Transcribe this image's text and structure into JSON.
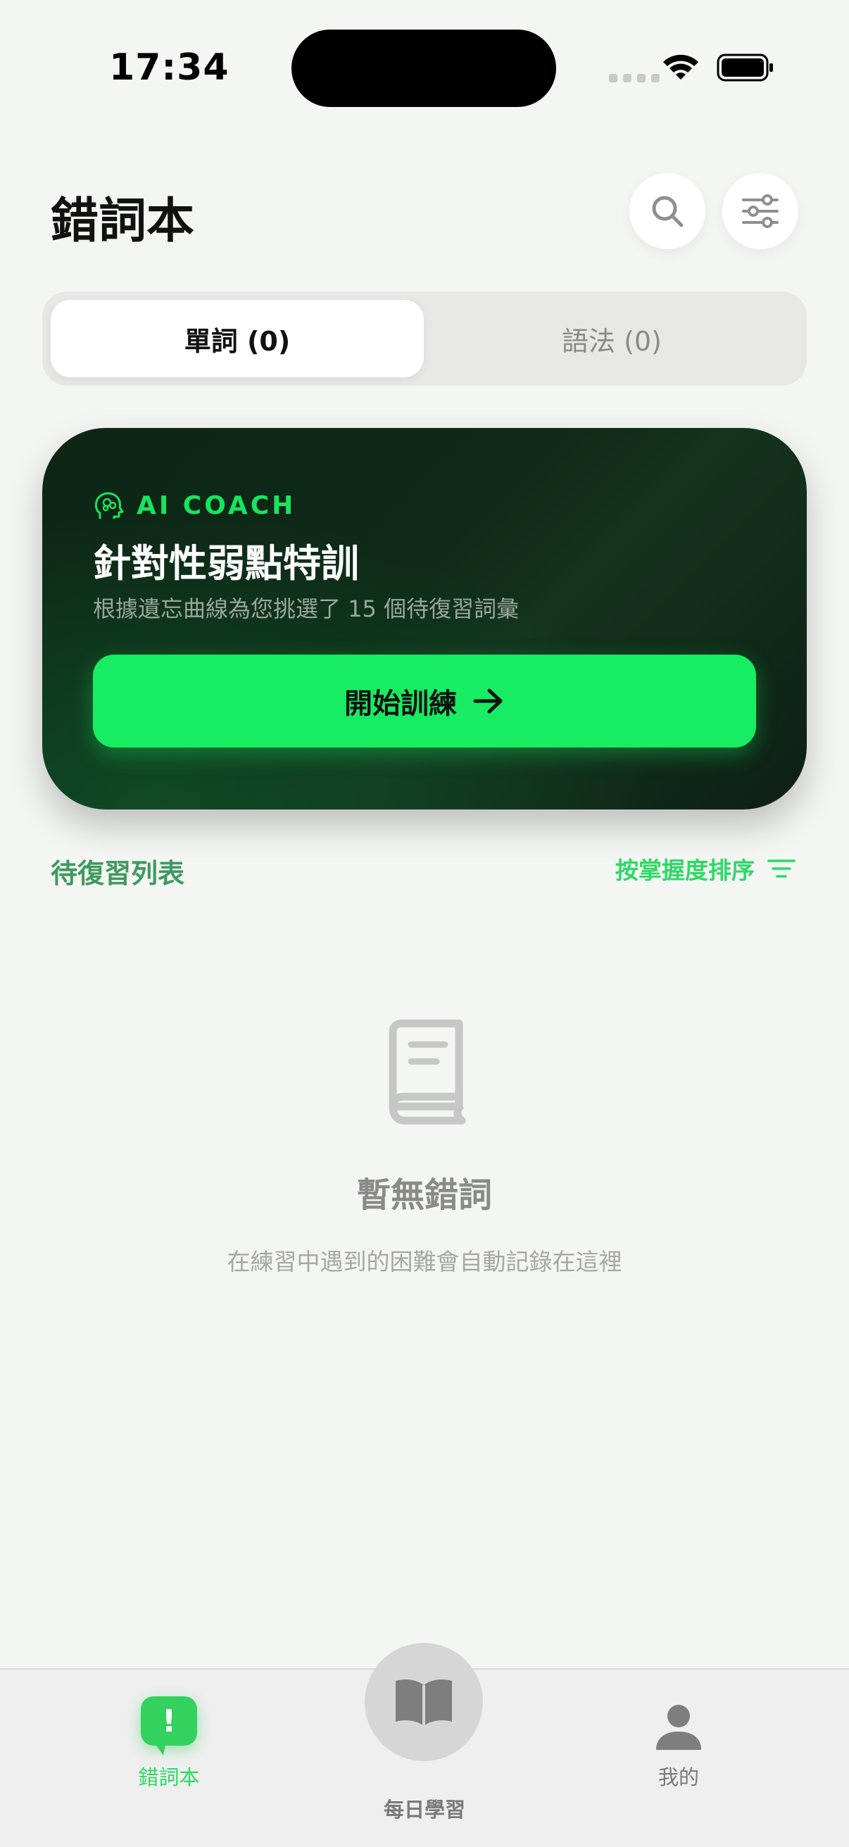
{
  "status_bar": {
    "time": "17:34"
  },
  "header": {
    "title": "錯詞本",
    "search_icon": "search-icon",
    "filter_icon": "sliders-icon"
  },
  "segments": [
    {
      "label": "單詞 (0)",
      "selected": true
    },
    {
      "label": "語法 (0)",
      "selected": false
    }
  ],
  "coach_card": {
    "icon": "brain-head-icon",
    "label": "AI COACH",
    "title": "針對性弱點特訓",
    "subtitle": "根據遺忘曲線為您挑選了 15 個待復習詞彙",
    "button_label": "開始訓練",
    "button_icon": "arrow-right-icon"
  },
  "list": {
    "title": "待復習列表",
    "sort_label": "按掌握度排序",
    "sort_icon": "sort-lines-icon"
  },
  "empty_state": {
    "icon": "book-icon",
    "title": "暫無錯詞",
    "subtitle": "在練習中遇到的困難會自動記錄在這裡"
  },
  "tab_bar": {
    "items": [
      {
        "label": "錯詞本",
        "icon": "exclamation-bubble-icon",
        "active": true
      },
      {
        "label": "每日學習",
        "icon": "open-book-icon",
        "active": false
      },
      {
        "label": "我的",
        "icon": "person-icon",
        "active": false
      }
    ]
  },
  "colors": {
    "accent": "#17ec62",
    "card_bg": "#0e2a18",
    "background": "#f4f6f3"
  }
}
